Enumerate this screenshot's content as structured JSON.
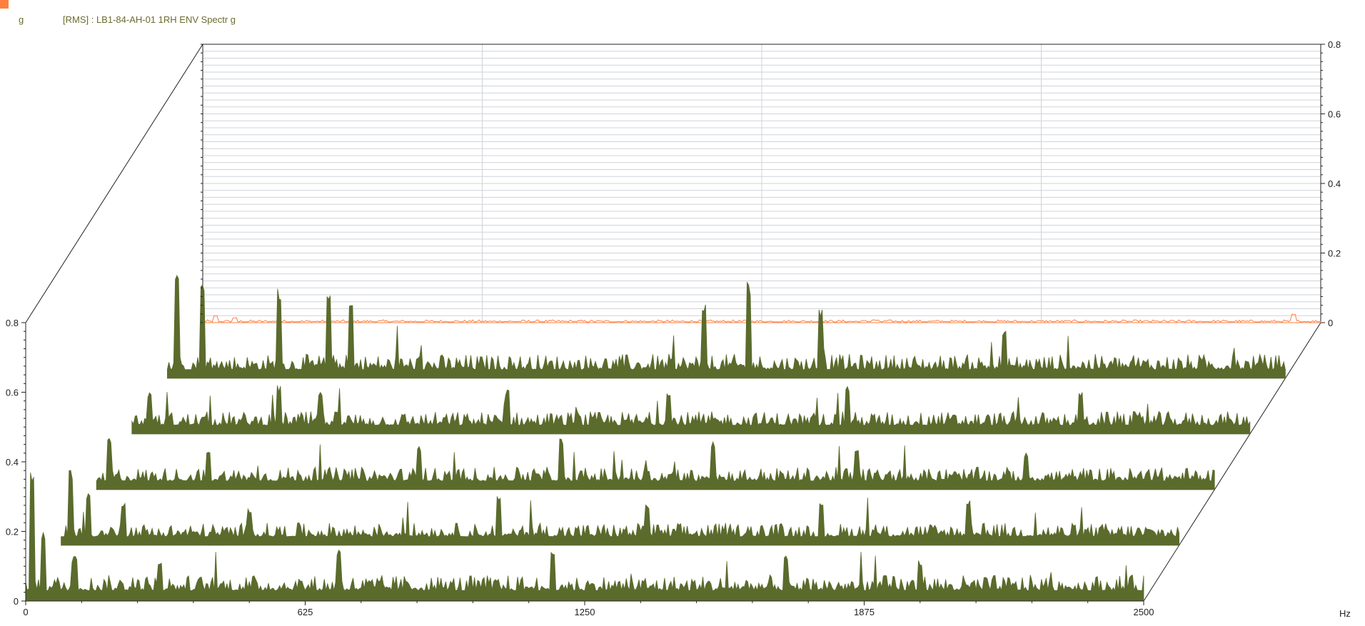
{
  "header": {
    "unit_label": "g",
    "title": "[RMS] : LB1-84-AH-01 1RH ENV Spectr g"
  },
  "colors": {
    "corner_marker": "#ff7f3f",
    "spectrum_fill": "#5a6b2c",
    "back_spectrum": "#ff7f3f",
    "grid": "#d0d3d8",
    "axis": "#222222"
  },
  "chart_data": {
    "type": "waterfall-spectrum",
    "title": "[RMS] : LB1-84-AH-01 1RH ENV Spectr g",
    "xlabel": "Hz",
    "ylabel": "g",
    "xlim": [
      0,
      2500
    ],
    "ylim": [
      0,
      0.8
    ],
    "x_ticks": [
      "0",
      "625",
      "1250",
      "1875",
      "2500"
    ],
    "y_ticks_front": [
      "0",
      "0.2",
      "0.4",
      "0.6",
      "0.8"
    ],
    "y_ticks_back": [
      "0",
      "0.2",
      "0.4",
      "0.6",
      "0.8"
    ],
    "grid": true,
    "series": [
      {
        "layer": 0,
        "baseline": 0.03,
        "noise": 0.045,
        "peaks": [
          [
            15,
            0.37
          ],
          [
            40,
            0.2
          ],
          [
            110,
            0.14
          ],
          [
            300,
            0.12
          ],
          [
            700,
            0.15
          ],
          [
            1180,
            0.14
          ],
          [
            1700,
            0.13
          ],
          [
            2000,
            0.12
          ]
        ]
      },
      {
        "layer": 1,
        "baseline": 0.025,
        "noise": 0.04,
        "peaks": [
          [
            20,
            0.22
          ],
          [
            60,
            0.15
          ],
          [
            140,
            0.13
          ],
          [
            420,
            0.11
          ],
          [
            980,
            0.14
          ],
          [
            1310,
            0.12
          ],
          [
            1700,
            0.12
          ],
          [
            2030,
            0.13
          ]
        ]
      },
      {
        "layer": 2,
        "baseline": 0.025,
        "noise": 0.04,
        "peaks": [
          [
            30,
            0.15
          ],
          [
            250,
            0.12
          ],
          [
            720,
            0.13
          ],
          [
            1040,
            0.15
          ],
          [
            1380,
            0.14
          ],
          [
            1700,
            0.12
          ],
          [
            2080,
            0.11
          ]
        ]
      },
      {
        "layer": 3,
        "baseline": 0.025,
        "noise": 0.04,
        "peaks": [
          [
            40,
            0.12
          ],
          [
            330,
            0.14
          ],
          [
            420,
            0.12
          ],
          [
            840,
            0.13
          ],
          [
            1200,
            0.12
          ],
          [
            1600,
            0.14
          ],
          [
            2120,
            0.12
          ]
        ]
      },
      {
        "layer": 4,
        "baseline": 0.025,
        "noise": 0.045,
        "peaks": [
          [
            20,
            0.32
          ],
          [
            80,
            0.28
          ],
          [
            250,
            0.26
          ],
          [
            360,
            0.25
          ],
          [
            410,
            0.22
          ],
          [
            1200,
            0.22
          ],
          [
            1300,
            0.28
          ],
          [
            1460,
            0.2
          ],
          [
            1870,
            0.14
          ]
        ]
      },
      {
        "layer": 5,
        "baseline": 0.002,
        "noise": 0.006,
        "peaks": [
          [
            30,
            0.02
          ],
          [
            70,
            0.015
          ],
          [
            1500,
            0.008
          ],
          [
            2440,
            0.025
          ]
        ]
      }
    ]
  }
}
